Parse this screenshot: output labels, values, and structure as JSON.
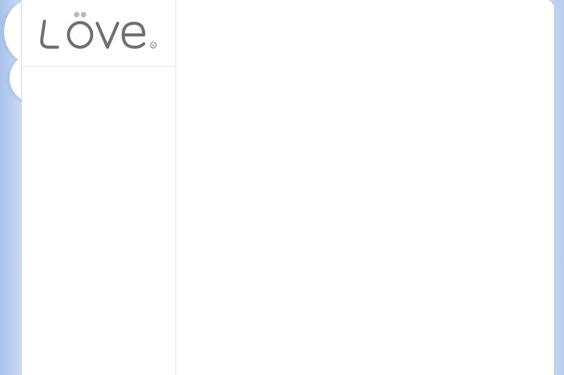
{
  "brand": {
    "name": "Löve",
    "registered_mark": "®",
    "logo_color": "#6f6f6f",
    "dots_color": "#b9b9b9"
  },
  "sidebar": {
    "items": []
  },
  "main": {
    "content": []
  },
  "colors": {
    "background_edge": "#a9c3ec",
    "panel": "#ffffff",
    "border": "#d8d8d8"
  }
}
